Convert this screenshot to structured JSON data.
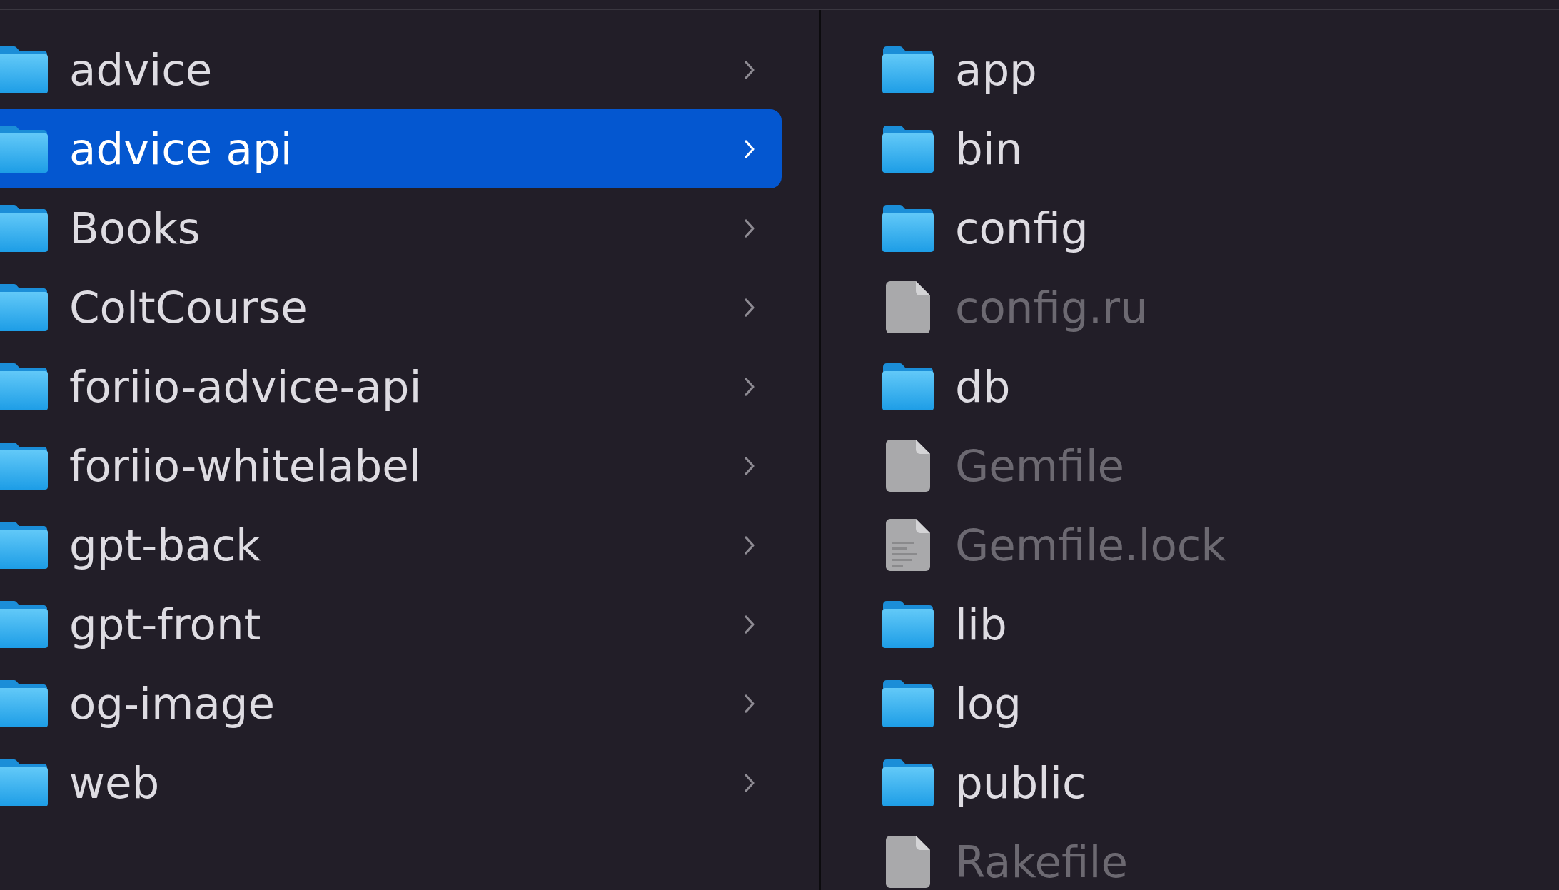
{
  "columns": [
    {
      "items": [
        {
          "name": "advice",
          "kind": "folder",
          "selected": false
        },
        {
          "name": "advice api",
          "kind": "folder",
          "selected": true
        },
        {
          "name": "Books",
          "kind": "folder",
          "selected": false
        },
        {
          "name": "ColtCourse",
          "kind": "folder",
          "selected": false
        },
        {
          "name": "foriio-advice-api",
          "kind": "folder",
          "selected": false
        },
        {
          "name": "foriio-whitelabel",
          "kind": "folder",
          "selected": false
        },
        {
          "name": "gpt-back",
          "kind": "folder",
          "selected": false
        },
        {
          "name": "gpt-front",
          "kind": "folder",
          "selected": false
        },
        {
          "name": "og-image",
          "kind": "folder",
          "selected": false
        },
        {
          "name": "web",
          "kind": "folder",
          "selected": false
        }
      ]
    },
    {
      "items": [
        {
          "name": "app",
          "kind": "folder",
          "selected": false,
          "disabled": false
        },
        {
          "name": "bin",
          "kind": "folder",
          "selected": false,
          "disabled": false
        },
        {
          "name": "config",
          "kind": "folder",
          "selected": false,
          "disabled": false
        },
        {
          "name": "config.ru",
          "kind": "file",
          "selected": false,
          "disabled": true
        },
        {
          "name": "db",
          "kind": "folder",
          "selected": false,
          "disabled": false
        },
        {
          "name": "Gemfile",
          "kind": "file",
          "selected": false,
          "disabled": true
        },
        {
          "name": "Gemfile.lock",
          "kind": "document",
          "selected": false,
          "disabled": true
        },
        {
          "name": "lib",
          "kind": "folder",
          "selected": false,
          "disabled": false
        },
        {
          "name": "log",
          "kind": "folder",
          "selected": false,
          "disabled": false
        },
        {
          "name": "public",
          "kind": "folder",
          "selected": false,
          "disabled": false
        },
        {
          "name": "Rakefile",
          "kind": "file",
          "selected": false,
          "disabled": true
        }
      ]
    }
  ]
}
